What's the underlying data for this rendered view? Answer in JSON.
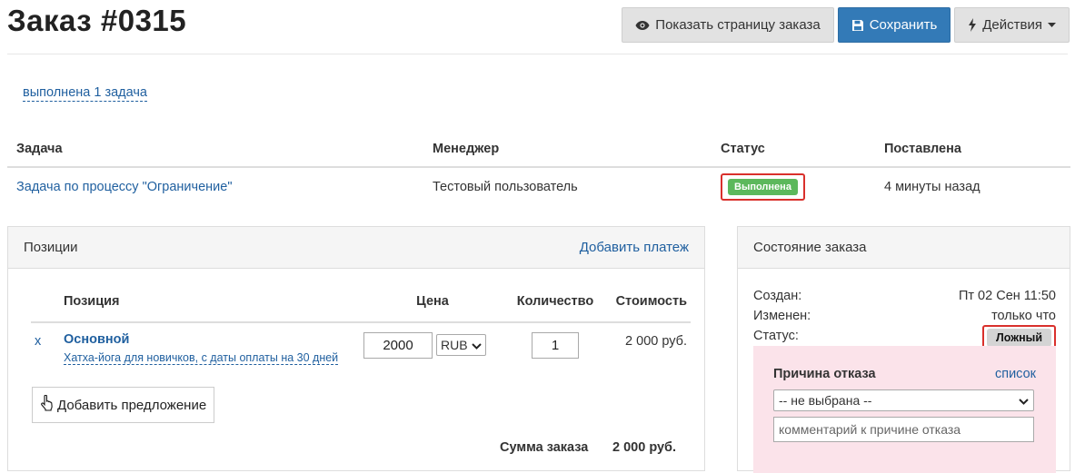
{
  "header": {
    "title": "Заказ #0315",
    "show_page_label": "Показать страницу заказа",
    "save_label": "Сохранить",
    "actions_label": "Действия"
  },
  "tasks_summary": "выполнена 1 задача",
  "tasks_table": {
    "columns": [
      "Задача",
      "Менеджер",
      "Статус",
      "Поставлена"
    ],
    "rows": [
      {
        "task": "Задача по процессу \"Ограничение\"",
        "manager": "Тестовый пользователь",
        "status": "Выполнена",
        "created": "4 минуты назад"
      }
    ]
  },
  "positions_panel": {
    "title": "Позиции",
    "add_payment_label": "Добавить платеж",
    "columns": [
      "Позиция",
      "Цена",
      "Количество",
      "Стоимость"
    ],
    "items": [
      {
        "remove": "x",
        "name": "Основной",
        "subtitle": "Хатха-йога для новичков, с даты оплаты на 30 дней",
        "price": "2000",
        "currency": "RUB",
        "quantity": "1",
        "cost": "2 000 руб."
      }
    ],
    "add_offer_label": "Добавить предложение",
    "total_label": "Сумма заказа",
    "total_value": "2 000 руб."
  },
  "state_panel": {
    "title": "Состояние заказа",
    "created_label": "Создан:",
    "created_value": "Пт 02 Сен 11:50",
    "modified_label": "Изменен:",
    "modified_value": "только что",
    "status_label": "Статус:",
    "status_value": "Ложный",
    "reject": {
      "title": "Причина отказа",
      "list_link": "список",
      "select_value": "-- не выбрана --",
      "comment_placeholder": "комментарий к причине отказа"
    }
  },
  "colors": {
    "primary": "#337ab7",
    "success": "#5cb85c",
    "highlight_border": "#d9302c",
    "reject_bg": "#fbe3ea",
    "link": "#1f5f9f"
  },
  "icons": {
    "show_page": "eye-icon",
    "save": "floppy-disk-icon",
    "actions": "lightning-icon",
    "actions_caret": "caret-down-icon",
    "currency_caret": "chevron-down-icon",
    "add_offer": "hand-pointer-icon",
    "reject_caret": "chevron-down-icon"
  }
}
